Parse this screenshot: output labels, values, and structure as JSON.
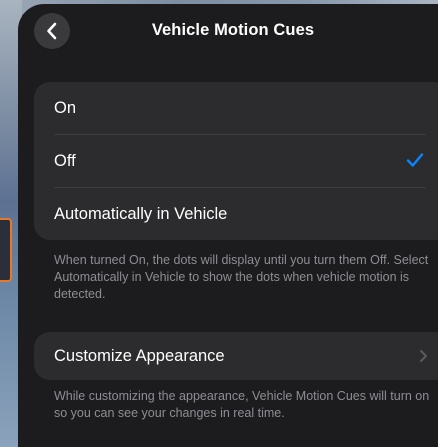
{
  "header": {
    "title": "Vehicle Motion Cues",
    "back_icon": "chevron-left-icon"
  },
  "options": {
    "items": [
      {
        "label": "On",
        "selected": false
      },
      {
        "label": "Off",
        "selected": true
      },
      {
        "label": "Automatically in Vehicle",
        "selected": false
      }
    ],
    "check_icon": "checkmark-icon",
    "footnote": "When turned On, the dots will display until you turn them Off. Select Automatically in Vehicle to show the dots when vehicle motion is detected."
  },
  "customize": {
    "label": "Customize Appearance",
    "chevron_icon": "chevron-right-icon",
    "footnote": "While customizing the appearance, Vehicle Motion Cues will turn on so you can see your changes in real time."
  },
  "colors": {
    "accent": "#0a84ff",
    "panel_background": "#1c1c1e",
    "group_background": "#2c2c2e",
    "secondary_text": "#8e8e93",
    "side_widget_border": "#e8782a"
  }
}
